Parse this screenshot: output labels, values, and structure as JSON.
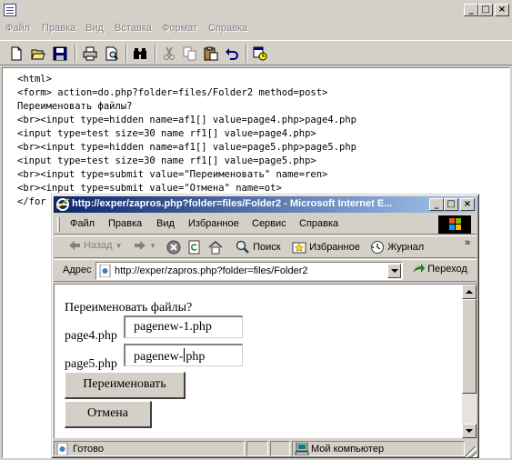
{
  "editor": {
    "menu": [
      "Файл",
      "Правка",
      "Вид",
      "Вставка",
      "Формат",
      "Справка"
    ],
    "toolbar_icons": [
      "new-icon",
      "open-icon",
      "save-icon",
      "print-icon",
      "print-preview-icon",
      "find-icon",
      "cut-icon",
      "copy-icon",
      "paste-icon",
      "undo-icon",
      "insert-datetime-icon"
    ],
    "code_lines": [
      "<html>",
      "<form> action=do.php?folder=files/Folder2 method=post>",
      "Переименовать файлы?",
      "<br><input type=hidden name=af1[] value=page4.php>page4.php",
      "<input type=test size=30 name rf1[] value=page4.php>",
      "<br><input type=hidden name=af1[] value=page5.php>page5.php",
      "<input type=test size=30 name rf1[] value=page5.php>",
      "<br><input type=submit value=\"Переименовать\" name=ren>",
      "<br><input type=submit value=\"Отмена\" name=ot>",
      "</for"
    ]
  },
  "ie": {
    "title": "http://exper/zapros.php?folder=files/Folder2 - Microsoft Internet E...",
    "menu": [
      "Файл",
      "Правка",
      "Вид",
      "Избранное",
      "Сервис",
      "Справка"
    ],
    "nav": {
      "back": "Назад",
      "search": "Поиск",
      "favorites": "Избранное",
      "history": "Журнал",
      "more": "»"
    },
    "address_label": "Адрес",
    "address_value": "http://exper/zapros.php?folder=files/Folder2",
    "go_label": "Переход",
    "page": {
      "heading": "Переименовать файлы?",
      "file1_label": "page4.php",
      "file1_value": "pagenew-1.php",
      "file2_label": "page5.php",
      "file2_value_before_caret": "pagenew-",
      "file2_value_after_caret": "php",
      "rename_button": "Переименовать",
      "cancel_button": "Отмена"
    },
    "status": {
      "text": "Готово",
      "zone": "Мой компьютер"
    }
  }
}
